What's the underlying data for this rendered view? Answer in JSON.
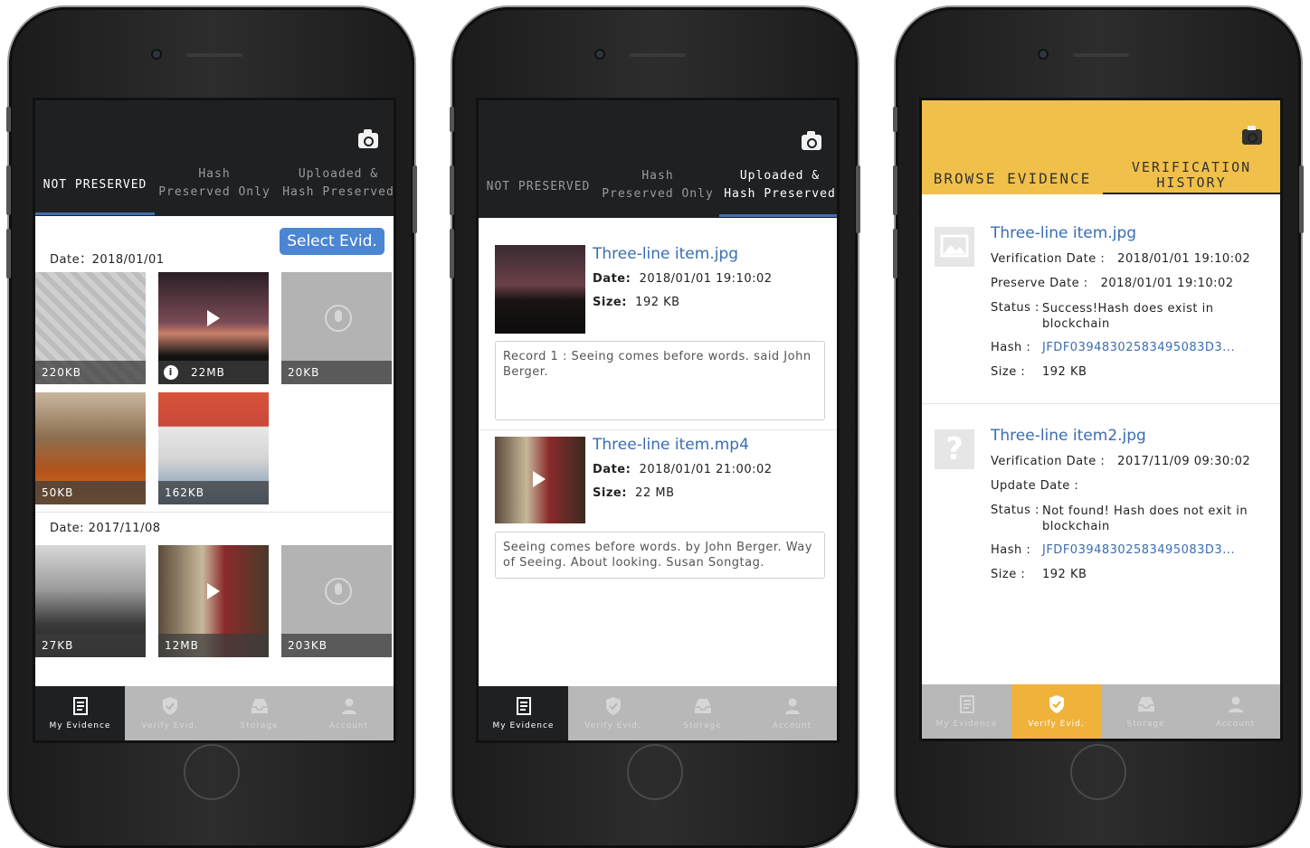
{
  "phone1": {
    "tabs": [
      {
        "label": "NOT PRESERVED"
      },
      {
        "label": "Hash\nPreserved Only"
      },
      {
        "label": "Uploaded &\nHash Preserved"
      }
    ],
    "select_button": "Select Evid.",
    "groups": [
      {
        "date": "Date：2018/01/01",
        "items": [
          "220KB",
          "22MB",
          "20KB",
          "50KB",
          "162KB"
        ]
      },
      {
        "date": "Date: 2017/11/08",
        "items": [
          "27KB",
          "12MB",
          "203KB"
        ]
      }
    ]
  },
  "phone2": {
    "tabs": [
      {
        "label": "NOT PRESERVED"
      },
      {
        "label": "Hash\nPreserved Only"
      },
      {
        "label": "Uploaded &\nHash Preserved"
      }
    ],
    "items": [
      {
        "name": "Three-line item.jpg",
        "date_label": "Date:",
        "date": "2018/01/01   19:10:02",
        "size_label": "Size:",
        "size": "192 KB",
        "note": "Record 1 : Seeing comes before words. said John Berger."
      },
      {
        "name": "Three-line item.mp4",
        "date_label": "Date:",
        "date": "2018/01/01 21:00:02",
        "size_label": "Size:",
        "size": "22 MB",
        "note": "Seeing comes before words. by John Berger. Way of Seeing. About looking. Susan Songtag."
      }
    ]
  },
  "phone3": {
    "tabs": [
      {
        "label": "BROWSE EVIDENCE"
      },
      {
        "label": "VERIFICATION\nHISTORY"
      }
    ],
    "items": [
      {
        "name": "Three-line item.jpg",
        "verif_label": "Verification Date :",
        "verif_date": "2018/01/01   19:10:02",
        "second_label": "Preserve Date :",
        "second_value": "2018/01/01  19:10:02",
        "status_label": "Status :",
        "status": "Success!Hash does exist in blockchain",
        "hash_label": "Hash :",
        "hash": "JFDF03948302583495083D3...",
        "size_label": "Size :",
        "size": "192 KB"
      },
      {
        "name": "Three-line item2.jpg",
        "verif_label": "Verification Date :",
        "verif_date": "2017/11/09   09:30:02",
        "second_label": "Update Date :",
        "second_value": "",
        "status_label": "Status :",
        "status": "Not found! Hash does not exit in blockchain",
        "hash_label": "Hash :",
        "hash": "JFDF03948302583495083D3...",
        "size_label": "Size :",
        "size": "192 KB"
      }
    ]
  },
  "nav": [
    "My Evidence",
    "Verify Evid.",
    "Storage",
    "Account"
  ],
  "colors": {
    "accent_blue": "#3f6fb0",
    "accent_yellow": "#f0c04a",
    "nav_yellow": "#f0b23a",
    "dark": "#1f2021"
  }
}
